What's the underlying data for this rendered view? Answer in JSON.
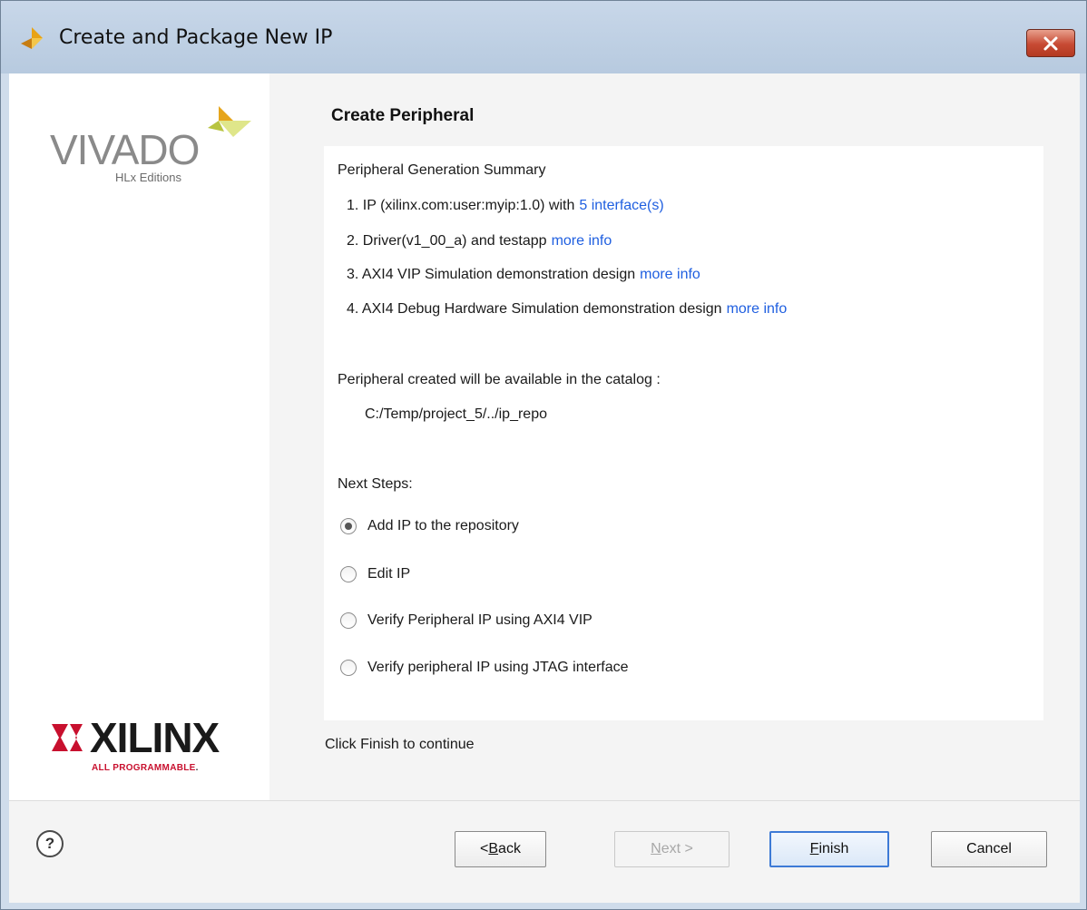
{
  "window": {
    "title": "Create and Package New IP"
  },
  "branding": {
    "vivado_word": "VIVADO",
    "vivado_sub": "HLx Editions",
    "xilinx_word": "XILINX",
    "xilinx_sub_red": "ALL PROGRAMMABLE",
    "xilinx_sub_tm": "."
  },
  "page": {
    "title": "Create Peripheral",
    "summary_heading": "Peripheral Generation Summary",
    "summary_items": [
      {
        "text": "1. IP (xilinx.com:user:myip:1.0) with",
        "link": "5 interface(s)"
      },
      {
        "text": "2. Driver(v1_00_a) and testapp",
        "link": "more info"
      },
      {
        "text": "3. AXI4 VIP Simulation demonstration design",
        "link": "more info"
      },
      {
        "text": "4. AXI4 Debug Hardware Simulation demonstration design",
        "link": "more info"
      }
    ],
    "catalog_text": "Peripheral created will be available in the catalog :",
    "catalog_path": "C:/Temp/project_5/../ip_repo",
    "next_steps_label": "Next Steps:",
    "options": [
      {
        "label": "Add IP to the repository",
        "selected": true
      },
      {
        "label": "Edit IP",
        "selected": false
      },
      {
        "label": "Verify Peripheral IP using AXI4 VIP",
        "selected": false
      },
      {
        "label": "Verify peripheral IP using JTAG interface",
        "selected": false
      }
    ],
    "hint": "Click Finish to continue"
  },
  "buttons": {
    "help": "?",
    "back_prefix": "< ",
    "back_mnemonic": "B",
    "back_rest": "ack",
    "next_mnemonic": "N",
    "next_rest": "ext >",
    "finish_mnemonic": "F",
    "finish_rest": "inish",
    "cancel": "Cancel"
  },
  "colors": {
    "link": "#1f5fe0",
    "vivado_accent": "#c8d34a",
    "xilinx_red": "#c8102e"
  }
}
